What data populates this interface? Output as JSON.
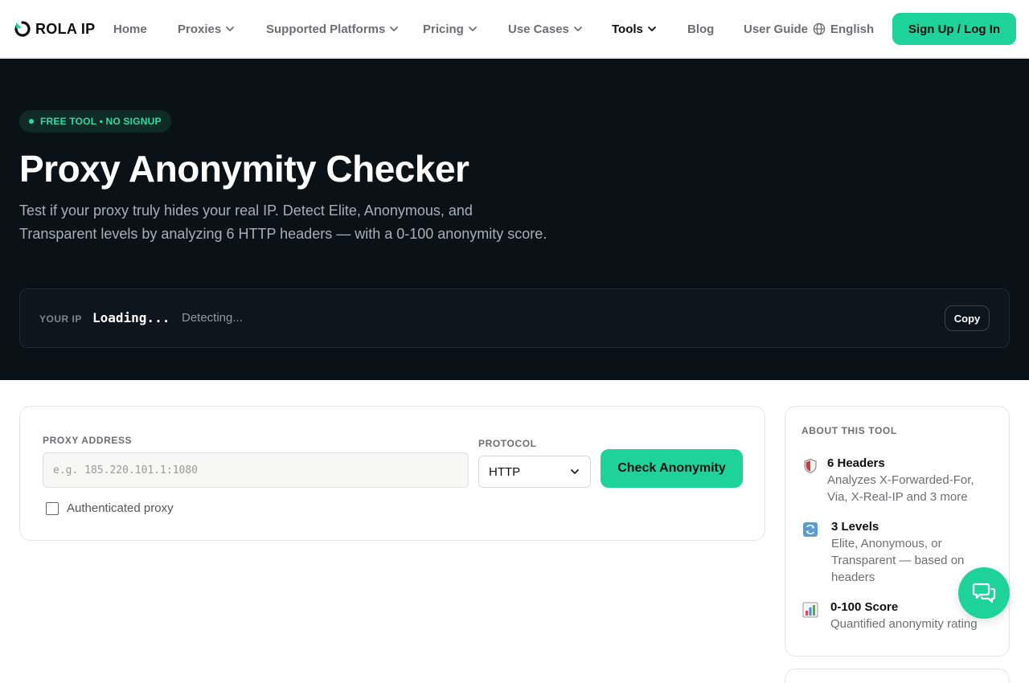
{
  "brand": {
    "name": "ROLA IP"
  },
  "nav": {
    "items": [
      {
        "label": "Home",
        "has_dropdown": false
      },
      {
        "label": "Proxies",
        "has_dropdown": true
      },
      {
        "label": "Supported Platforms",
        "has_dropdown": true
      },
      {
        "label": "Pricing",
        "has_dropdown": true
      },
      {
        "label": "Use Cases",
        "has_dropdown": true
      },
      {
        "label": "Tools",
        "has_dropdown": true,
        "active": true
      },
      {
        "label": "Blog",
        "has_dropdown": false
      },
      {
        "label": "User Guide",
        "has_dropdown": false
      }
    ],
    "language": "English",
    "cta": "Sign Up / Log In"
  },
  "hero": {
    "badge": "FREE TOOL • NO SIGNUP",
    "title": "Proxy Anonymity Checker",
    "description": "Test if your proxy truly hides your real IP. Detect Elite, Anonymous, and Transparent levels by analyzing 6 HTTP headers — with a 0-100 anonymity score.",
    "ip": {
      "label": "YOUR IP",
      "value": "Loading...",
      "status": "Detecting...",
      "copy_label": "Copy"
    }
  },
  "checker": {
    "proxy_label": "PROXY ADDRESS",
    "proxy_placeholder": "e.g. 185.220.101.1:1080",
    "protocol_label": "PROTOCOL",
    "protocol_value": "HTTP",
    "submit_label": "Check Anonymity",
    "auth_label": "Authenticated proxy"
  },
  "about": {
    "title": "ABOUT THIS TOOL",
    "features": [
      {
        "icon": "shield-icon",
        "title": "6 Headers",
        "desc": "Analyzes X-Forwarded-For, Via, X-Real-IP and 3 more"
      },
      {
        "icon": "refresh-icon",
        "title": "3 Levels",
        "desc": "Elite, Anonymous, or Transparent — based on headers"
      },
      {
        "icon": "bar-chart-icon",
        "title": "0-100 Score",
        "desc": "Quantified anonymity rating"
      }
    ]
  },
  "colors": {
    "accent": "#1ed39a",
    "hero_bg": "#0a1217",
    "badge_text": "#2fdca0"
  }
}
